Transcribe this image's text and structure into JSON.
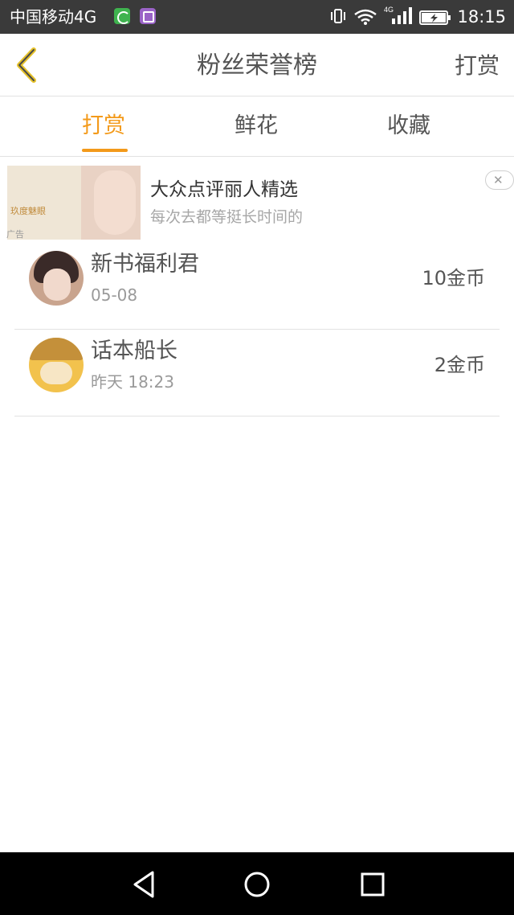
{
  "status_bar": {
    "carrier": "中国移动4G",
    "network": "4G",
    "time": "18:15"
  },
  "header": {
    "title": "粉丝荣誉榜",
    "reward_label": "打赏"
  },
  "tabs": [
    {
      "label": "打赏",
      "active": true
    },
    {
      "label": "鲜花",
      "active": false
    },
    {
      "label": "收藏",
      "active": false
    }
  ],
  "ad": {
    "title": "大众点评丽人精选",
    "subtitle": "每次去都等挺长时间的",
    "label": "广告",
    "image_text": "玖度魅眼"
  },
  "list": [
    {
      "name": "新书福利君",
      "date": "05-08",
      "amount": "10金币"
    },
    {
      "name": "话本船长",
      "date": "昨天 18:23",
      "amount": "2金币"
    }
  ],
  "colors": {
    "accent": "#f39a1a",
    "status_bar": "#3a3a3a",
    "text_primary": "#555555",
    "text_secondary": "#9a9a9a",
    "nav_bar": "#000000"
  }
}
